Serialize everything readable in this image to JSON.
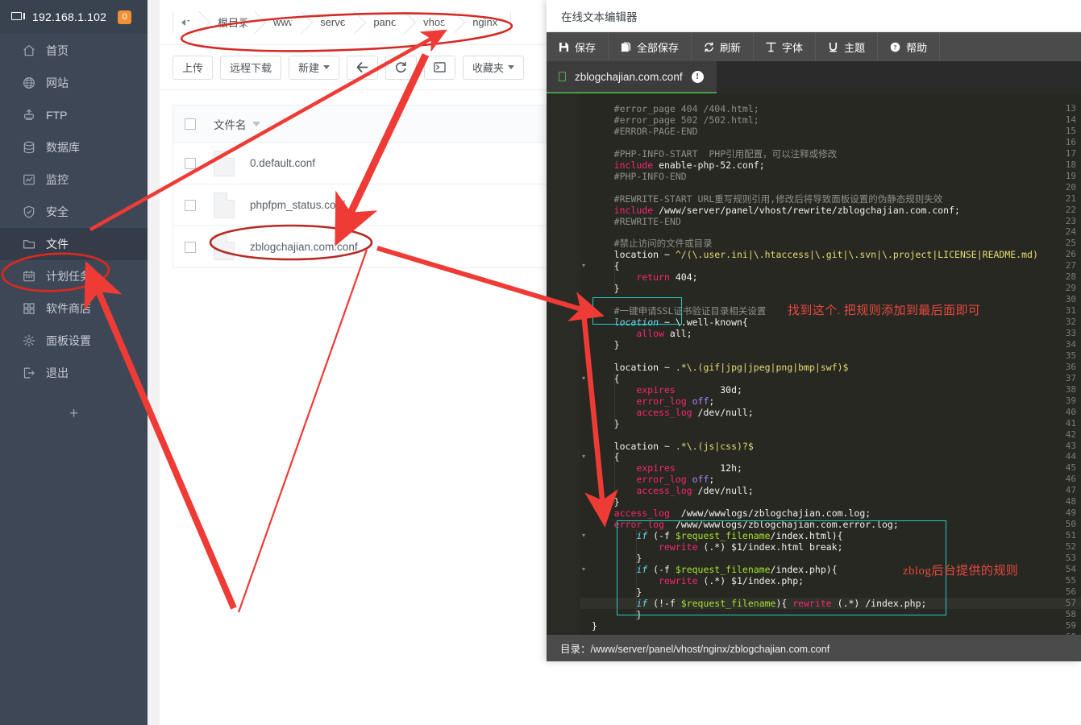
{
  "sidebar": {
    "ip": "192.168.1.102",
    "badge": "0",
    "items": [
      {
        "label": "首页",
        "icon": "home-icon"
      },
      {
        "label": "网站",
        "icon": "globe-icon"
      },
      {
        "label": "FTP",
        "icon": "ftp-icon"
      },
      {
        "label": "数据库",
        "icon": "database-icon"
      },
      {
        "label": "监控",
        "icon": "chart-icon"
      },
      {
        "label": "安全",
        "icon": "shield-icon"
      },
      {
        "label": "文件",
        "icon": "folder-icon"
      },
      {
        "label": "计划任务",
        "icon": "calendar-icon"
      },
      {
        "label": "软件商店",
        "icon": "grid-icon"
      },
      {
        "label": "面板设置",
        "icon": "gear-icon"
      },
      {
        "label": "退出",
        "icon": "logout-icon"
      }
    ],
    "add_label": "+"
  },
  "filemanager": {
    "breadcrumb": [
      "根目录",
      "www",
      "server",
      "panel",
      "vhost",
      "nginx"
    ],
    "toolbar": {
      "upload": "上传",
      "remote_download": "远程下载",
      "new": "新建",
      "back_icon": "arrow-left-icon",
      "refresh_icon": "refresh-icon",
      "terminal_icon": "terminal-icon",
      "favorites": "收藏夹",
      "root_label": "根目录"
    },
    "columns": [
      "文件名"
    ],
    "rows": [
      {
        "name": "0.default.conf"
      },
      {
        "name": "phpfpm_status.conf"
      },
      {
        "name": "zblogchajian.com.conf"
      }
    ]
  },
  "editor": {
    "window_title": "在线文本编辑器",
    "toolbar": [
      {
        "label": "保存",
        "icon": "save-icon"
      },
      {
        "label": "全部保存",
        "icon": "save-all-icon"
      },
      {
        "label": "刷新",
        "icon": "refresh-icon"
      },
      {
        "label": "字体",
        "icon": "font-icon"
      },
      {
        "label": "主题",
        "icon": "theme-icon"
      },
      {
        "label": "帮助",
        "icon": "help-icon"
      }
    ],
    "tab": {
      "name": "zblogchajian.com.conf",
      "info_icon": "info-icon"
    },
    "footer": "目录：/www/server/panel/vhost/nginx/zblogchajian.com.conf",
    "first_line": 13,
    "lines": [
      {
        "n": 13,
        "indent": 1,
        "tokens": [
          {
            "t": "#error_page 404 /404.html;",
            "c": "c-com"
          }
        ]
      },
      {
        "n": 14,
        "indent": 1,
        "tokens": [
          {
            "t": "#error_page 502 /502.html;",
            "c": "c-com"
          }
        ]
      },
      {
        "n": 15,
        "indent": 1,
        "tokens": [
          {
            "t": "#ERROR-PAGE-END",
            "c": "c-com"
          }
        ]
      },
      {
        "n": 16,
        "indent": 0,
        "tokens": []
      },
      {
        "n": 17,
        "indent": 1,
        "tokens": [
          {
            "t": "#PHP-INFO-START  PHP引用配置，可以注释或修改",
            "c": "c-com"
          }
        ]
      },
      {
        "n": 18,
        "indent": 1,
        "tokens": [
          {
            "t": "include",
            "c": "c-key"
          },
          {
            "t": " enable-php-52.conf;",
            "c": "c-wht"
          }
        ]
      },
      {
        "n": 19,
        "indent": 1,
        "tokens": [
          {
            "t": "#PHP-INFO-END",
            "c": "c-com"
          }
        ]
      },
      {
        "n": 20,
        "indent": 0,
        "tokens": []
      },
      {
        "n": 21,
        "indent": 1,
        "tokens": [
          {
            "t": "#REWRITE-START URL重写规则引用,修改后将导致面板设置的伪静态规则失效",
            "c": "c-com"
          }
        ]
      },
      {
        "n": 22,
        "indent": 1,
        "tokens": [
          {
            "t": "include",
            "c": "c-key"
          },
          {
            "t": " /www/server/panel/vhost/rewrite/zblogchajian.com.conf;",
            "c": "c-wht"
          }
        ]
      },
      {
        "n": 23,
        "indent": 1,
        "tokens": [
          {
            "t": "#REWRITE-END",
            "c": "c-com"
          }
        ]
      },
      {
        "n": 24,
        "indent": 0,
        "tokens": []
      },
      {
        "n": 25,
        "indent": 1,
        "tokens": [
          {
            "t": "#禁止访问的文件或目录",
            "c": "c-com"
          }
        ]
      },
      {
        "n": 26,
        "indent": 1,
        "tokens": [
          {
            "t": "location",
            "c": "c-wht"
          },
          {
            "t": " ~ ",
            "c": "c-wht"
          },
          {
            "t": "^/(\\.user.ini|\\.htaccess|\\.git|\\.svn|\\.project|LICENSE|README.md)",
            "c": "c-str"
          }
        ]
      },
      {
        "n": 27,
        "indent": 1,
        "fold": true,
        "tokens": [
          {
            "t": "{",
            "c": "c-wht"
          }
        ]
      },
      {
        "n": 28,
        "indent": 2,
        "tokens": [
          {
            "t": "return",
            "c": "c-key"
          },
          {
            "t": " ",
            "c": "c-wht"
          },
          {
            "t": "404",
            "c": "c-num"
          },
          {
            "t": ";",
            "c": "c-wht"
          }
        ]
      },
      {
        "n": 29,
        "indent": 1,
        "tokens": [
          {
            "t": "}",
            "c": "c-wht"
          }
        ]
      },
      {
        "n": 30,
        "indent": 0,
        "tokens": []
      },
      {
        "n": 31,
        "indent": 1,
        "tokens": [
          {
            "t": "#一键申请SSL证书验证目录相关设置",
            "c": "c-com"
          }
        ]
      },
      {
        "n": 32,
        "indent": 1,
        "tokens": [
          {
            "t": "location",
            "c": "c-fn"
          },
          {
            "t": " ~ ",
            "c": "c-wht"
          },
          {
            "t": "\\.well-known{",
            "c": "c-wht"
          }
        ]
      },
      {
        "n": 33,
        "indent": 2,
        "tokens": [
          {
            "t": "allow",
            "c": "c-key"
          },
          {
            "t": " all;",
            "c": "c-wht"
          }
        ]
      },
      {
        "n": 34,
        "indent": 1,
        "tokens": [
          {
            "t": "}",
            "c": "c-wht"
          }
        ]
      },
      {
        "n": 35,
        "indent": 0,
        "tokens": []
      },
      {
        "n": 36,
        "indent": 1,
        "tokens": [
          {
            "t": "location",
            "c": "c-wht"
          },
          {
            "t": " ~ ",
            "c": "c-wht"
          },
          {
            "t": ".*\\.(gif|jpg|jpeg|png|bmp|swf)$",
            "c": "c-str"
          }
        ]
      },
      {
        "n": 37,
        "indent": 1,
        "fold": true,
        "tokens": [
          {
            "t": "{",
            "c": "c-wht"
          }
        ]
      },
      {
        "n": 38,
        "indent": 2,
        "tokens": [
          {
            "t": "expires",
            "c": "c-key"
          },
          {
            "t": "        30d;",
            "c": "c-wht"
          }
        ]
      },
      {
        "n": 39,
        "indent": 2,
        "tokens": [
          {
            "t": "error_log",
            "c": "c-key"
          },
          {
            "t": " ",
            "c": "c-wht"
          },
          {
            "t": "off",
            "c": "c-blu"
          },
          {
            "t": ";",
            "c": "c-wht"
          }
        ]
      },
      {
        "n": 40,
        "indent": 2,
        "tokens": [
          {
            "t": "access_log",
            "c": "c-key"
          },
          {
            "t": " /dev/null;",
            "c": "c-wht"
          }
        ]
      },
      {
        "n": 41,
        "indent": 1,
        "tokens": [
          {
            "t": "}",
            "c": "c-wht"
          }
        ]
      },
      {
        "n": 42,
        "indent": 0,
        "tokens": []
      },
      {
        "n": 43,
        "indent": 1,
        "tokens": [
          {
            "t": "location",
            "c": "c-wht"
          },
          {
            "t": " ~ ",
            "c": "c-wht"
          },
          {
            "t": ".*\\.(js|css)?$",
            "c": "c-str"
          }
        ]
      },
      {
        "n": 44,
        "indent": 1,
        "fold": true,
        "tokens": [
          {
            "t": "{",
            "c": "c-wht"
          }
        ]
      },
      {
        "n": 45,
        "indent": 2,
        "tokens": [
          {
            "t": "expires",
            "c": "c-key"
          },
          {
            "t": "        12h;",
            "c": "c-wht"
          }
        ]
      },
      {
        "n": 46,
        "indent": 2,
        "tokens": [
          {
            "t": "error_log",
            "c": "c-key"
          },
          {
            "t": " ",
            "c": "c-wht"
          },
          {
            "t": "off",
            "c": "c-blu"
          },
          {
            "t": ";",
            "c": "c-wht"
          }
        ]
      },
      {
        "n": 47,
        "indent": 2,
        "tokens": [
          {
            "t": "access_log",
            "c": "c-key"
          },
          {
            "t": " /dev/null;",
            "c": "c-wht"
          }
        ]
      },
      {
        "n": 48,
        "indent": 1,
        "tokens": [
          {
            "t": "}",
            "c": "c-wht"
          }
        ]
      },
      {
        "n": 49,
        "indent": 1,
        "tokens": [
          {
            "t": "access_log",
            "c": "c-key"
          },
          {
            "t": "  /www/wwwlogs/zblogchajian.com.log;",
            "c": "c-wht"
          }
        ]
      },
      {
        "n": 50,
        "indent": 1,
        "tokens": [
          {
            "t": "error_log",
            "c": "c-key"
          },
          {
            "t": "  /www/wwwlogs/zblogchajian.com.error.log;",
            "c": "c-wht"
          }
        ]
      },
      {
        "n": 51,
        "indent": 2,
        "fold": true,
        "tokens": [
          {
            "t": "if",
            "c": "c-fn"
          },
          {
            "t": " (-f ",
            "c": "c-wht"
          },
          {
            "t": "$request_filename",
            "c": "c-var"
          },
          {
            "t": "/index.html){",
            "c": "c-wht"
          }
        ]
      },
      {
        "n": 52,
        "indent": 3,
        "tokens": [
          {
            "t": "rewrite",
            "c": "c-key"
          },
          {
            "t": " (.*) $1/index.html break;",
            "c": "c-wht"
          }
        ]
      },
      {
        "n": 53,
        "indent": 2,
        "tokens": [
          {
            "t": "}",
            "c": "c-wht"
          }
        ]
      },
      {
        "n": 54,
        "indent": 2,
        "fold": true,
        "tokens": [
          {
            "t": "if",
            "c": "c-fn"
          },
          {
            "t": " (-f ",
            "c": "c-wht"
          },
          {
            "t": "$request_filename",
            "c": "c-var"
          },
          {
            "t": "/index.php){",
            "c": "c-wht"
          }
        ]
      },
      {
        "n": 55,
        "indent": 3,
        "tokens": [
          {
            "t": "rewrite",
            "c": "c-key"
          },
          {
            "t": " (.*) $1/index.php;",
            "c": "c-wht"
          }
        ]
      },
      {
        "n": 56,
        "indent": 2,
        "tokens": [
          {
            "t": "}",
            "c": "c-wht"
          }
        ]
      },
      {
        "n": 57,
        "indent": 2,
        "cursor": true,
        "tokens": [
          {
            "t": "if",
            "c": "c-fn"
          },
          {
            "t": " (!-f ",
            "c": "c-wht"
          },
          {
            "t": "$request_filename",
            "c": "c-var"
          },
          {
            "t": "){ ",
            "c": "c-wht"
          },
          {
            "t": "rewrite",
            "c": "c-key"
          },
          {
            "t": " (.*) /index.php;",
            "c": "c-wht"
          }
        ]
      },
      {
        "n": 58,
        "indent": 2,
        "tokens": [
          {
            "t": "}",
            "c": "c-wht"
          }
        ]
      },
      {
        "n": 59,
        "indent": 0,
        "tokens": [
          {
            "t": "}",
            "c": "c-wht"
          }
        ]
      },
      {
        "n": 60,
        "indent": 0,
        "tokens": []
      }
    ]
  },
  "annotations": {
    "note_ssl": "找到这个. 把规则添加到最后面即可",
    "note_zblog": "zblog后台提供的规则",
    "accent_red": "#e8483f",
    "accent_teal": "#25c9c0"
  }
}
